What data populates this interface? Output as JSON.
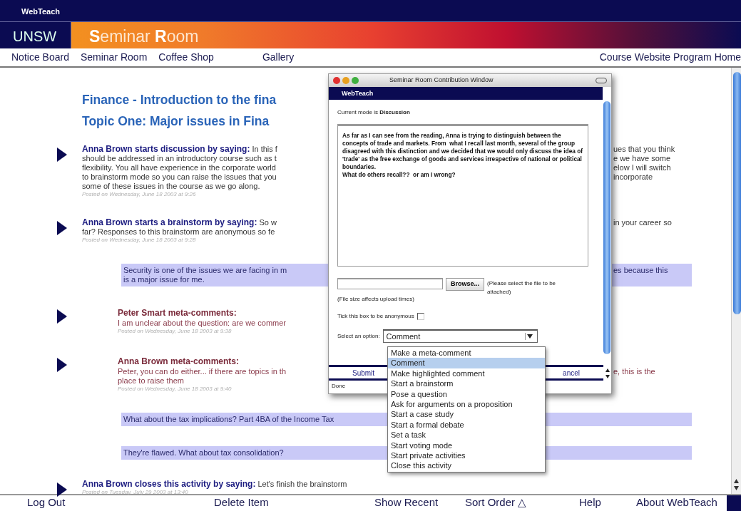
{
  "app_name": "WebTeach",
  "brand": "UNSW",
  "banner_title": "**S**eminar **R**oom",
  "nav_left": [
    "Notice Board",
    "Seminar Room",
    "Coffee Shop",
    "Gallery"
  ],
  "nav_right": [
    "Course Website",
    "Program Home"
  ],
  "headings": [
    "Finance - Introduction to the fina",
    "Topic One: Major issues in Fina"
  ],
  "items": [
    {
      "kind": "post",
      "author": "Anna Brown starts discussion by saying:",
      "lines": [
        {
          "left": "In this f",
          "right": "ues that you think"
        },
        {
          "left": "should be addressed in an introductory course such as t",
          "right": "e we have some"
        },
        {
          "left": "flexibility. You all have experience in the corporate world",
          "right": "elow I will switch"
        },
        {
          "left": "to brainstorm mode so you can raise the issues that you",
          "right": "incorporate"
        },
        {
          "left": "some of these issues in the course as we go along."
        }
      ],
      "posted": "Posted on Wednesday, June 18 2003 at 9:26"
    },
    {
      "kind": "post",
      "author": "Anna Brown starts a brainstorm by saying:",
      "lines": [
        {
          "left": "So w",
          "right": "in your career so"
        },
        {
          "left": "far? Responses to this brainstorm are anonymous so fe"
        }
      ],
      "posted": "Posted on Wednesday, June 18 2003 at 9:28"
    },
    {
      "kind": "response",
      "lines": [
        {
          "left": "Security is one of the issues we are facing in m",
          "right": "es because this"
        },
        {
          "left": "is a major issue for me."
        }
      ]
    },
    {
      "kind": "meta",
      "author": "Peter Smart meta-comments:",
      "lines": [
        {
          "left": "I am unclear about the question: are we commer"
        }
      ],
      "posted": "Posted on Wednesday, June 18 2003 at 9:38"
    },
    {
      "kind": "meta",
      "author": "Anna Brown meta-comments:",
      "lines": [
        {
          "left": "Peter, you can do either... if there are topics in th",
          "right": "e, this is the"
        },
        {
          "left": "place to raise them"
        }
      ],
      "posted": "Posted on Wednesday, June 18 2003 at 9:40"
    },
    {
      "kind": "response",
      "lines": [
        {
          "left": "What about the tax implications? Part 4BA of the Income Tax"
        }
      ]
    },
    {
      "kind": "response",
      "lines": [
        {
          "left": "They're flawed. What about tax consolidation?"
        }
      ]
    },
    {
      "kind": "post",
      "author": "Anna Brown closes this activity by saying:",
      "lines": [
        {
          "left": "Let's finish the brainstorm"
        }
      ],
      "posted": "Posted on Tuesday, July 29 2003 at 13:40"
    }
  ],
  "contribution_window": {
    "title": "Seminar Room Contribution Window",
    "app_name": "WebTeach",
    "mode_label": "Current mode is **Discussion**",
    "message": "As far as I can see from the reading, Anna is trying to distinguish between the concepts of trade and markets. From  what I recall last month, several of the group disagreed with this distinction and we decided that we would only discuss the idea of 'trade' as the free exchange of goods and services irrespective of national or political boundaries.\nWhat do others recall??  or am I wrong?",
    "browse_label": "Browse...",
    "file_hint": "(Please select the file to be attached)",
    "size_hint": "(File size affects upload times)",
    "anonymous_label": "Tick this box to be anonymous",
    "anonymous_checked": false,
    "option_label": "Select an option:",
    "option_value": "Comment",
    "options": [
      {
        "label": "Make a meta-comment",
        "selected": false
      },
      {
        "label": "Comment",
        "selected": true
      },
      {
        "label": "Make highlighted comment",
        "selected": false
      },
      {
        "label": "Start a brainstorm",
        "selected": false
      },
      {
        "label": "Pose a question",
        "selected": false
      },
      {
        "label": "Ask for arguments on a proposition",
        "selected": false
      },
      {
        "label": "Start a case study",
        "selected": false
      },
      {
        "label": "Start a formal debate",
        "selected": false
      },
      {
        "label": "Set a task",
        "selected": false
      },
      {
        "label": "Start voting mode",
        "selected": false
      },
      {
        "label": "Start private activities",
        "selected": false
      },
      {
        "label": "Close this activity",
        "selected": false
      }
    ],
    "submit": "Submit",
    "cancel": "ancel",
    "status": "Done"
  },
  "footer": [
    "Log Out",
    "Delete Item",
    "Show Recent",
    "Sort Order △",
    "Help",
    "About WebTeach"
  ]
}
